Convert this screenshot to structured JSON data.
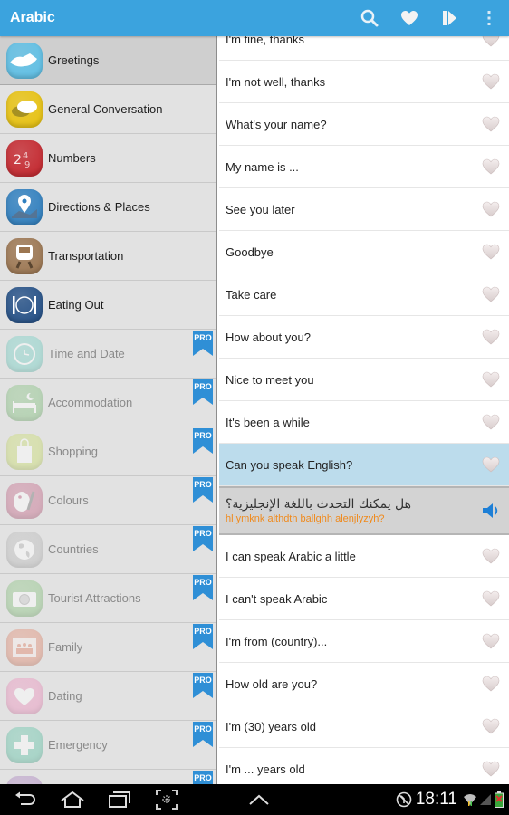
{
  "header": {
    "title": "Arabic",
    "actions": [
      {
        "name": "search",
        "icon": "search-icon"
      },
      {
        "name": "favorites",
        "icon": "heart-icon"
      },
      {
        "name": "play",
        "icon": "play-icon"
      },
      {
        "name": "overflow-menu",
        "icon": "more-vert-icon"
      }
    ]
  },
  "colors": {
    "accent": "#3ba3de",
    "selected_phrase_bg": "#bcdcec",
    "translation_bg": "#d3d3d3",
    "transliteration": "#f08a1c",
    "pro_badge": "#2f8fd6"
  },
  "sidebar": {
    "items": [
      {
        "label": "Greetings",
        "icon": "handshake-icon",
        "color": "#5fc0e6",
        "locked": false,
        "selected": true
      },
      {
        "label": "General Conversation",
        "icon": "speech-bubbles-icon",
        "color": "#e8c20f",
        "locked": false,
        "selected": false
      },
      {
        "label": "Numbers",
        "icon": "numbers-icon",
        "color": "#c4262d",
        "locked": false,
        "selected": false
      },
      {
        "label": "Directions & Places",
        "icon": "map-pin-icon",
        "color": "#2f7fbf",
        "locked": false,
        "selected": false
      },
      {
        "label": "Transportation",
        "icon": "train-icon",
        "color": "#9c7651",
        "locked": false,
        "selected": false
      },
      {
        "label": "Eating Out",
        "icon": "plate-icon",
        "color": "#234f86",
        "locked": false,
        "selected": false
      },
      {
        "label": "Time and Date",
        "icon": "clock-icon",
        "color": "#6fcfc3",
        "locked": true,
        "selected": false
      },
      {
        "label": "Accommodation",
        "icon": "bed-icon",
        "color": "#7fbf7a",
        "locked": true,
        "selected": false
      },
      {
        "label": "Shopping",
        "icon": "shopping-bag-icon",
        "color": "#c9dd6a",
        "locked": true,
        "selected": false
      },
      {
        "label": "Colours",
        "icon": "palette-icon",
        "color": "#c46385",
        "locked": true,
        "selected": false
      },
      {
        "label": "Countries",
        "icon": "globe-icon",
        "color": "#b8b8b8",
        "locked": true,
        "selected": false
      },
      {
        "label": "Tourist Attractions",
        "icon": "camera-icon",
        "color": "#86c27c",
        "locked": true,
        "selected": false
      },
      {
        "label": "Family",
        "icon": "family-photo-icon",
        "color": "#e2876c",
        "locked": true,
        "selected": false
      },
      {
        "label": "Dating",
        "icon": "heart-icon",
        "color": "#ee8dbb",
        "locked": true,
        "selected": false
      },
      {
        "label": "Emergency",
        "icon": "medical-cross-icon",
        "color": "#5cc3a5",
        "locked": true,
        "selected": false
      },
      {
        "label": "",
        "icon": "category-icon",
        "color": "#a87dbd",
        "locked": true,
        "selected": false
      }
    ],
    "pro_label": "PRO"
  },
  "phrases": {
    "items": [
      {
        "text": "I'm fine, thanks",
        "selected": false
      },
      {
        "text": "I'm not well, thanks",
        "selected": false
      },
      {
        "text": "What's your name?",
        "selected": false
      },
      {
        "text": "My name is ...",
        "selected": false
      },
      {
        "text": "See you later",
        "selected": false
      },
      {
        "text": "Goodbye",
        "selected": false
      },
      {
        "text": "Take care",
        "selected": false
      },
      {
        "text": "How about you?",
        "selected": false
      },
      {
        "text": "Nice to meet you",
        "selected": false
      },
      {
        "text": "It's been a while",
        "selected": false
      },
      {
        "text": "Can you speak English?",
        "selected": true,
        "translation": {
          "arabic": "هل يمكنك التحدث باللغة الإنجليزية؟",
          "transliteration": "hl ymknk althdth ballghh alenjlyzyh?"
        }
      },
      {
        "text": "I can speak Arabic a little",
        "selected": false
      },
      {
        "text": "I can't speak Arabic",
        "selected": false
      },
      {
        "text": "I'm from (country)...",
        "selected": false
      },
      {
        "text": "How old are you?",
        "selected": false
      },
      {
        "text": "I'm (30) years old",
        "selected": false
      },
      {
        "text": "I'm ... years old",
        "selected": false
      }
    ]
  },
  "system_bar": {
    "time": "18:11",
    "buttons": [
      "back-icon",
      "home-icon",
      "recent-apps-icon",
      "screenshot-icon",
      "up-chevron-icon"
    ],
    "status_icons": [
      "sync-off-icon",
      "wifi-icon",
      "signal-icon",
      "battery-icon"
    ]
  }
}
